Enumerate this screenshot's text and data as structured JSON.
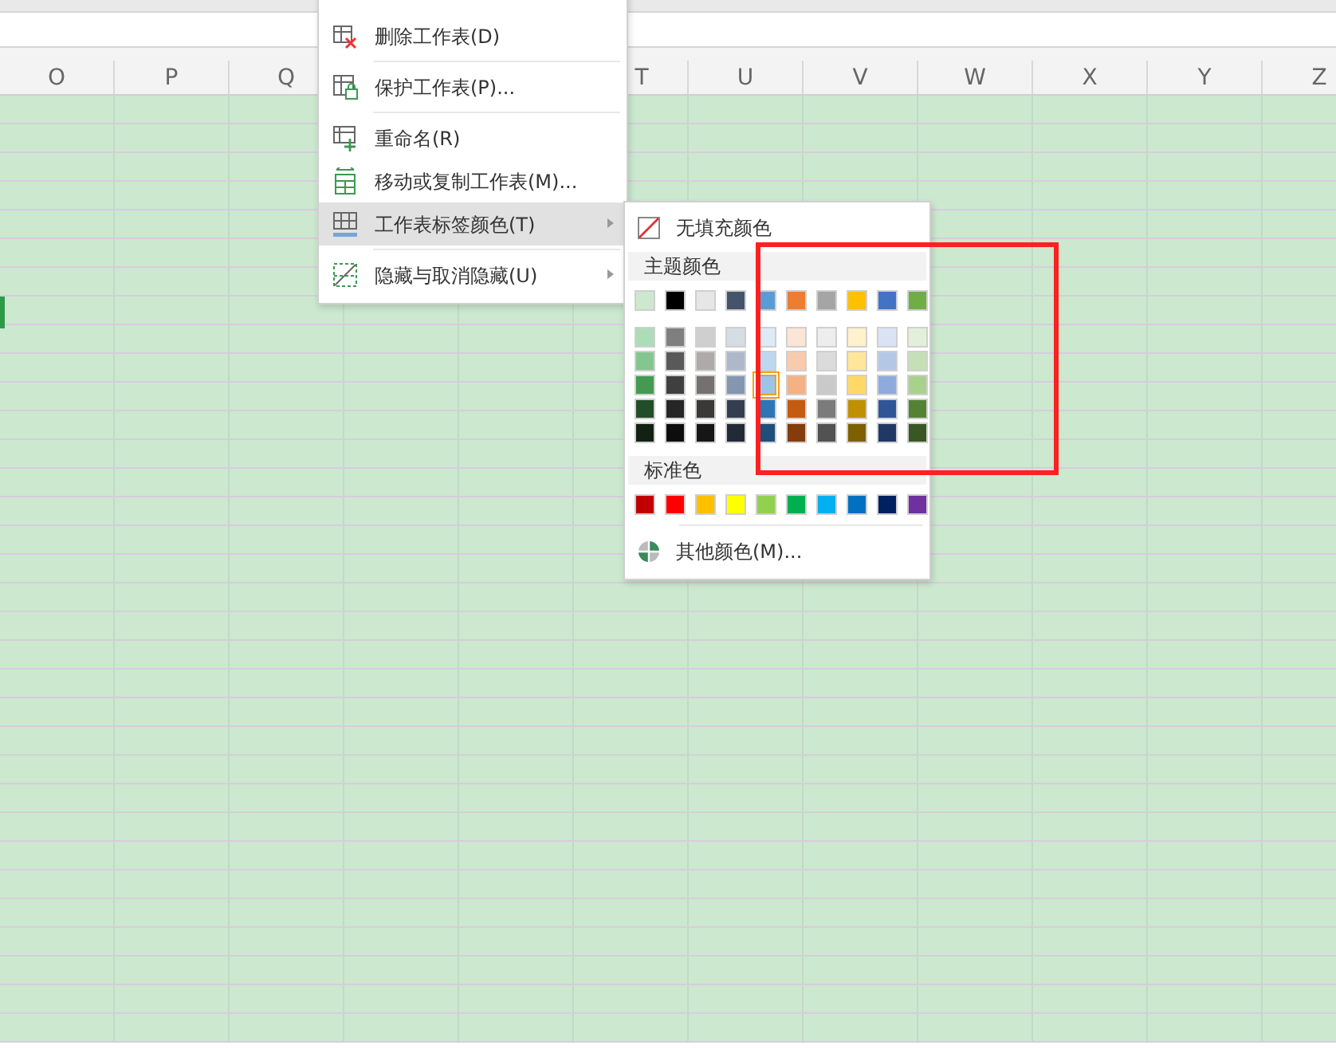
{
  "column_headers": [
    "O",
    "P",
    "Q",
    "T",
    "U",
    "V",
    "W",
    "X",
    "Y",
    "Z"
  ],
  "context_menu": {
    "items": [
      {
        "kind": "item",
        "label": "删除工作表(D)",
        "selected": false,
        "has_submenu": false
      },
      {
        "kind": "separator"
      },
      {
        "kind": "item",
        "label": "保护工作表(P)...",
        "selected": false,
        "has_submenu": false
      },
      {
        "kind": "separator"
      },
      {
        "kind": "item",
        "label": "重命名(R)",
        "selected": false,
        "has_submenu": false
      },
      {
        "kind": "item",
        "label": "移动或复制工作表(M)...",
        "selected": false,
        "has_submenu": false
      },
      {
        "kind": "item",
        "label": "工作表标签颜色(T)",
        "selected": true,
        "has_submenu": true
      },
      {
        "kind": "separator"
      },
      {
        "kind": "item",
        "label": "隐藏与取消隐藏(U)",
        "selected": false,
        "has_submenu": true
      }
    ]
  },
  "color_submenu": {
    "no_fill": "无填充颜色",
    "theme_heading": "主题颜色",
    "theme_colors": [
      {
        "color": "#cce8cf"
      },
      {
        "color": "#000000"
      },
      {
        "color": "#e7e6e6"
      },
      {
        "color": "#44546a"
      },
      {
        "color": "#5b9bd5"
      },
      {
        "color": "#ed7d31"
      },
      {
        "color": "#a5a5a5"
      },
      {
        "color": "#ffc000"
      },
      {
        "color": "#4472c4"
      },
      {
        "color": "#70ad47"
      }
    ],
    "shades": [
      [
        {
          "color": "#addcb8",
          "selected": false
        },
        {
          "color": "#7f7f7f",
          "selected": false
        },
        {
          "color": "#d0cece",
          "selected": false
        },
        {
          "color": "#d6dce4",
          "selected": false
        },
        {
          "color": "#deebf7",
          "selected": false
        },
        {
          "color": "#fbe5d6",
          "selected": false
        },
        {
          "color": "#ededed",
          "selected": false
        },
        {
          "color": "#fff2cc",
          "selected": false
        },
        {
          "color": "#dae3f3",
          "selected": false
        },
        {
          "color": "#e2f0d9",
          "selected": false
        }
      ],
      [
        {
          "color": "#84c68f",
          "selected": false
        },
        {
          "color": "#595959",
          "selected": false
        },
        {
          "color": "#aeaaaa",
          "selected": false
        },
        {
          "color": "#adb9ca",
          "selected": false
        },
        {
          "color": "#bdd7ee",
          "selected": false
        },
        {
          "color": "#f8cbad",
          "selected": false
        },
        {
          "color": "#dbdbdb",
          "selected": false
        },
        {
          "color": "#ffe699",
          "selected": false
        },
        {
          "color": "#b4c7e7",
          "selected": false
        },
        {
          "color": "#c5e0b4",
          "selected": false
        }
      ],
      [
        {
          "color": "#439a50",
          "selected": false
        },
        {
          "color": "#3f3f3f",
          "selected": false
        },
        {
          "color": "#757171",
          "selected": false
        },
        {
          "color": "#8497b0",
          "selected": false
        },
        {
          "color": "#9dc3e6",
          "selected": true
        },
        {
          "color": "#f4b183",
          "selected": false
        },
        {
          "color": "#c9c9c9",
          "selected": false
        },
        {
          "color": "#ffd966",
          "selected": false
        },
        {
          "color": "#8faadc",
          "selected": false
        },
        {
          "color": "#a9d18e",
          "selected": false
        }
      ],
      [
        {
          "color": "#234d28",
          "selected": false
        },
        {
          "color": "#262626",
          "selected": false
        },
        {
          "color": "#3b3838",
          "selected": false
        },
        {
          "color": "#333f4f",
          "selected": false
        },
        {
          "color": "#2e75b6",
          "selected": false
        },
        {
          "color": "#c55a11",
          "selected": false
        },
        {
          "color": "#7b7b7b",
          "selected": false
        },
        {
          "color": "#bf9000",
          "selected": false
        },
        {
          "color": "#2f5597",
          "selected": false
        },
        {
          "color": "#548235",
          "selected": false
        }
      ],
      [
        {
          "color": "#112214",
          "selected": false
        },
        {
          "color": "#0d0d0d",
          "selected": false
        },
        {
          "color": "#171616",
          "selected": false
        },
        {
          "color": "#222a35",
          "selected": false
        },
        {
          "color": "#1f4e79",
          "selected": false
        },
        {
          "color": "#843c0c",
          "selected": false
        },
        {
          "color": "#525252",
          "selected": false
        },
        {
          "color": "#7f6000",
          "selected": false
        },
        {
          "color": "#203864",
          "selected": false
        },
        {
          "color": "#385723",
          "selected": false
        }
      ]
    ],
    "standard_heading": "标准色",
    "standard_colors": [
      {
        "color": "#c00000"
      },
      {
        "color": "#ff0000"
      },
      {
        "color": "#ffc000"
      },
      {
        "color": "#ffff00"
      },
      {
        "color": "#92d050"
      },
      {
        "color": "#00b050"
      },
      {
        "color": "#00b0f0"
      },
      {
        "color": "#0070c0"
      },
      {
        "color": "#002060"
      },
      {
        "color": "#7030a0"
      }
    ],
    "more_colors": "其他颜色(M)..."
  },
  "annotations": [
    {
      "kind": "rectangle"
    }
  ]
}
